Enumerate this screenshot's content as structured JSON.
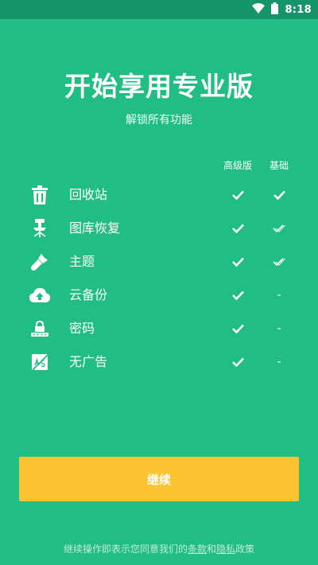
{
  "status_bar": {
    "time": "8:18",
    "icons": [
      "wifi-icon",
      "battery-icon"
    ]
  },
  "header": {
    "title": "开始享用专业版",
    "subtitle": "解锁所有功能"
  },
  "columns": {
    "premium": "高级版",
    "basic": "基础"
  },
  "features": [
    {
      "label": "回收站",
      "icon": "trash-icon",
      "premium": "check",
      "basic": "check"
    },
    {
      "label": "图库恢复",
      "icon": "recovery-icon",
      "premium": "check",
      "basic": "double-check"
    },
    {
      "label": "主题",
      "icon": "brush-icon",
      "premium": "check",
      "basic": "double-check"
    },
    {
      "label": "云备份",
      "icon": "cloud-upload-icon",
      "premium": "check",
      "basic": "-"
    },
    {
      "label": "密码",
      "icon": "lock-icon",
      "premium": "check",
      "basic": "-"
    },
    {
      "label": "无广告",
      "icon": "no-ads-icon",
      "premium": "check",
      "basic": "-"
    }
  ],
  "button": {
    "continue_label": "继续"
  },
  "footer": {
    "prefix": "继续操作即表示您同意我们的",
    "terms": "条款",
    "and": "和",
    "privacy": "隐私",
    "suffix": "政策"
  },
  "colors": {
    "background": "#20bd85",
    "status_bar": "#17956a",
    "button": "#fdc22f"
  }
}
